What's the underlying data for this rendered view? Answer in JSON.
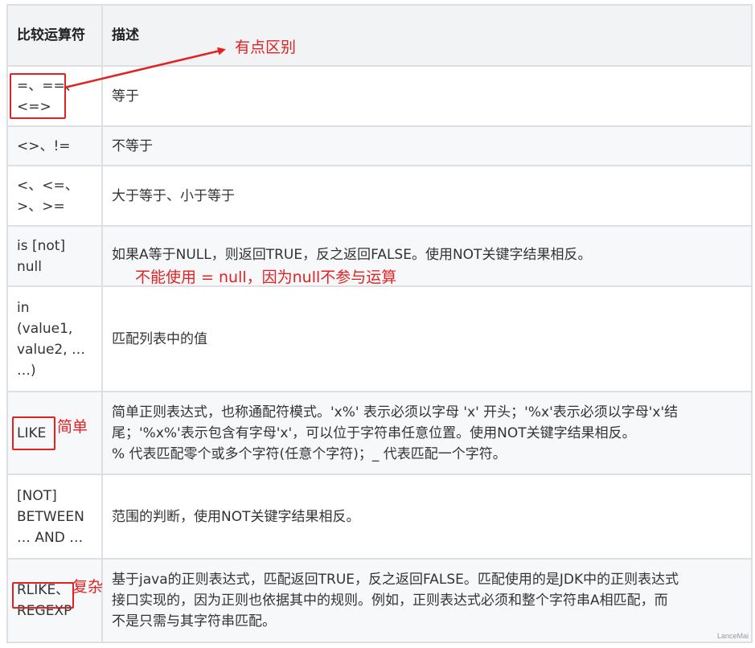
{
  "table": {
    "header": {
      "operator": "比较运算符",
      "description": "描述"
    },
    "rows": [
      {
        "operator": [
          "=、==、",
          "<=>"
        ],
        "description": [
          "等于"
        ]
      },
      {
        "operator": [
          "<>、!="
        ],
        "description": [
          "不等于"
        ]
      },
      {
        "operator": [
          "<、<=、",
          ">、>="
        ],
        "description": [
          "大于等于、小于等于"
        ]
      },
      {
        "operator": [
          "is [not]",
          "null"
        ],
        "description": [
          "如果A等于NULL，则返回TRUE，反之返回FALSE。使用NOT关键字结果相反。"
        ]
      },
      {
        "operator": [
          "in",
          "(value1,",
          "value2, …",
          "…)"
        ],
        "description": [
          "匹配列表中的值"
        ]
      },
      {
        "operator": [
          "LIKE"
        ],
        "description": [
          "简单正则表达式，也称通配符模式。'x%' 表示必须以字母 'x' 开头；'%x'表示必须以字母'x'结",
          "尾；'%x%'表示包含有字母'x'，可以位于字符串任意位置。使用NOT关键字结果相反。",
          "% 代表匹配零个或多个字符(任意个字符)；_ 代表匹配一个字符。"
        ]
      },
      {
        "operator": [
          "[NOT]",
          "BETWEEN",
          "… AND …"
        ],
        "description": [
          "范围的判断，使用NOT关键字结果相反。"
        ]
      },
      {
        "operator": [
          "RLIKE、",
          "REGEXP"
        ],
        "description": [
          "基于java的正则表达式，匹配返回TRUE，反之返回FALSE。匹配使用的是JDK中的正则表达式",
          "接口实现的，因为正则也依据其中的规则。例如，正则表达式必须和整个字符串A相匹配，而",
          "不是只需与其字符串匹配。"
        ]
      }
    ]
  },
  "annotations": {
    "arrow_label": "有点区别",
    "null_note": "不能使用 = null，因为null不参与运算",
    "simple_label": "简单",
    "complex_label": "复杂",
    "color": "#e02222"
  },
  "watermark": "LanceMai"
}
